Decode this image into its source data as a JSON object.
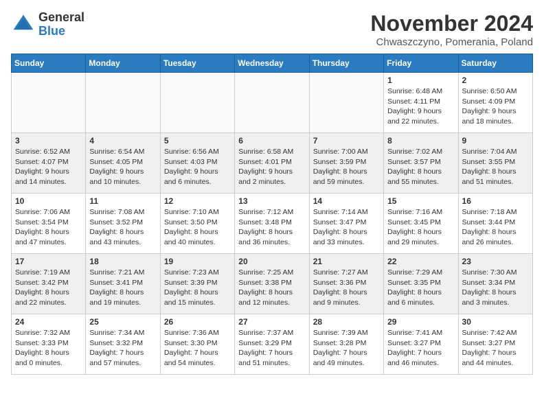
{
  "header": {
    "logo_line1": "General",
    "logo_line2": "Blue",
    "month_title": "November 2024",
    "subtitle": "Chwaszczyno, Pomerania, Poland"
  },
  "days_of_week": [
    "Sunday",
    "Monday",
    "Tuesday",
    "Wednesday",
    "Thursday",
    "Friday",
    "Saturday"
  ],
  "weeks": [
    {
      "shaded": false,
      "days": [
        {
          "date": "",
          "info": ""
        },
        {
          "date": "",
          "info": ""
        },
        {
          "date": "",
          "info": ""
        },
        {
          "date": "",
          "info": ""
        },
        {
          "date": "",
          "info": ""
        },
        {
          "date": "1",
          "info": "Sunrise: 6:48 AM\nSunset: 4:11 PM\nDaylight: 9 hours\nand 22 minutes."
        },
        {
          "date": "2",
          "info": "Sunrise: 6:50 AM\nSunset: 4:09 PM\nDaylight: 9 hours\nand 18 minutes."
        }
      ]
    },
    {
      "shaded": true,
      "days": [
        {
          "date": "3",
          "info": "Sunrise: 6:52 AM\nSunset: 4:07 PM\nDaylight: 9 hours\nand 14 minutes."
        },
        {
          "date": "4",
          "info": "Sunrise: 6:54 AM\nSunset: 4:05 PM\nDaylight: 9 hours\nand 10 minutes."
        },
        {
          "date": "5",
          "info": "Sunrise: 6:56 AM\nSunset: 4:03 PM\nDaylight: 9 hours\nand 6 minutes."
        },
        {
          "date": "6",
          "info": "Sunrise: 6:58 AM\nSunset: 4:01 PM\nDaylight: 9 hours\nand 2 minutes."
        },
        {
          "date": "7",
          "info": "Sunrise: 7:00 AM\nSunset: 3:59 PM\nDaylight: 8 hours\nand 59 minutes."
        },
        {
          "date": "8",
          "info": "Sunrise: 7:02 AM\nSunset: 3:57 PM\nDaylight: 8 hours\nand 55 minutes."
        },
        {
          "date": "9",
          "info": "Sunrise: 7:04 AM\nSunset: 3:55 PM\nDaylight: 8 hours\nand 51 minutes."
        }
      ]
    },
    {
      "shaded": false,
      "days": [
        {
          "date": "10",
          "info": "Sunrise: 7:06 AM\nSunset: 3:54 PM\nDaylight: 8 hours\nand 47 minutes."
        },
        {
          "date": "11",
          "info": "Sunrise: 7:08 AM\nSunset: 3:52 PM\nDaylight: 8 hours\nand 43 minutes."
        },
        {
          "date": "12",
          "info": "Sunrise: 7:10 AM\nSunset: 3:50 PM\nDaylight: 8 hours\nand 40 minutes."
        },
        {
          "date": "13",
          "info": "Sunrise: 7:12 AM\nSunset: 3:48 PM\nDaylight: 8 hours\nand 36 minutes."
        },
        {
          "date": "14",
          "info": "Sunrise: 7:14 AM\nSunset: 3:47 PM\nDaylight: 8 hours\nand 33 minutes."
        },
        {
          "date": "15",
          "info": "Sunrise: 7:16 AM\nSunset: 3:45 PM\nDaylight: 8 hours\nand 29 minutes."
        },
        {
          "date": "16",
          "info": "Sunrise: 7:18 AM\nSunset: 3:44 PM\nDaylight: 8 hours\nand 26 minutes."
        }
      ]
    },
    {
      "shaded": true,
      "days": [
        {
          "date": "17",
          "info": "Sunrise: 7:19 AM\nSunset: 3:42 PM\nDaylight: 8 hours\nand 22 minutes."
        },
        {
          "date": "18",
          "info": "Sunrise: 7:21 AM\nSunset: 3:41 PM\nDaylight: 8 hours\nand 19 minutes."
        },
        {
          "date": "19",
          "info": "Sunrise: 7:23 AM\nSunset: 3:39 PM\nDaylight: 8 hours\nand 15 minutes."
        },
        {
          "date": "20",
          "info": "Sunrise: 7:25 AM\nSunset: 3:38 PM\nDaylight: 8 hours\nand 12 minutes."
        },
        {
          "date": "21",
          "info": "Sunrise: 7:27 AM\nSunset: 3:36 PM\nDaylight: 8 hours\nand 9 minutes."
        },
        {
          "date": "22",
          "info": "Sunrise: 7:29 AM\nSunset: 3:35 PM\nDaylight: 8 hours\nand 6 minutes."
        },
        {
          "date": "23",
          "info": "Sunrise: 7:30 AM\nSunset: 3:34 PM\nDaylight: 8 hours\nand 3 minutes."
        }
      ]
    },
    {
      "shaded": false,
      "days": [
        {
          "date": "24",
          "info": "Sunrise: 7:32 AM\nSunset: 3:33 PM\nDaylight: 8 hours\nand 0 minutes."
        },
        {
          "date": "25",
          "info": "Sunrise: 7:34 AM\nSunset: 3:32 PM\nDaylight: 7 hours\nand 57 minutes."
        },
        {
          "date": "26",
          "info": "Sunrise: 7:36 AM\nSunset: 3:30 PM\nDaylight: 7 hours\nand 54 minutes."
        },
        {
          "date": "27",
          "info": "Sunrise: 7:37 AM\nSunset: 3:29 PM\nDaylight: 7 hours\nand 51 minutes."
        },
        {
          "date": "28",
          "info": "Sunrise: 7:39 AM\nSunset: 3:28 PM\nDaylight: 7 hours\nand 49 minutes."
        },
        {
          "date": "29",
          "info": "Sunrise: 7:41 AM\nSunset: 3:27 PM\nDaylight: 7 hours\nand 46 minutes."
        },
        {
          "date": "30",
          "info": "Sunrise: 7:42 AM\nSunset: 3:27 PM\nDaylight: 7 hours\nand 44 minutes."
        }
      ]
    }
  ]
}
